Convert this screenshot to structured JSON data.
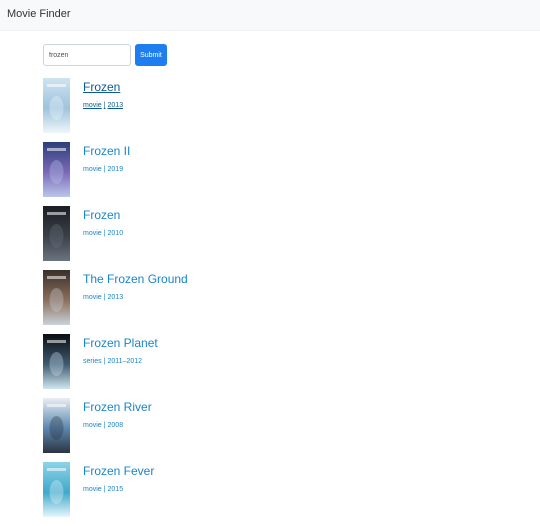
{
  "app": {
    "title": "Movie Finder"
  },
  "search": {
    "value": "frozen",
    "submit_label": "Submit"
  },
  "results": [
    {
      "title": "Frozen",
      "type": "movie",
      "year": "2013",
      "visited": true,
      "poster_colors": [
        "#cfe3f0",
        "#9ec3dc",
        "#eef6fb"
      ]
    },
    {
      "title": "Frozen II",
      "type": "movie",
      "year": "2019",
      "visited": false,
      "poster_colors": [
        "#2b3f7a",
        "#7b69b8",
        "#b9c6ea"
      ]
    },
    {
      "title": "Frozen",
      "type": "movie",
      "year": "2010",
      "visited": false,
      "poster_colors": [
        "#1a1d22",
        "#3b4048",
        "#6b7380"
      ]
    },
    {
      "title": "The Frozen Ground",
      "type": "movie",
      "year": "2013",
      "visited": false,
      "poster_colors": [
        "#3a2f2a",
        "#8b6f5c",
        "#c9d2da"
      ]
    },
    {
      "title": "Frozen Planet",
      "type": "series",
      "year": "2011–2012",
      "visited": false,
      "poster_colors": [
        "#0b0d12",
        "#3e5a70",
        "#cfe6f0"
      ]
    },
    {
      "title": "Frozen River",
      "type": "movie",
      "year": "2008",
      "visited": false,
      "poster_colors": [
        "#e9eef3",
        "#5c87b0",
        "#2b3442"
      ]
    },
    {
      "title": "Frozen Fever",
      "type": "movie",
      "year": "2015",
      "visited": false,
      "poster_colors": [
        "#8fd3e8",
        "#3fa9c9",
        "#e6f6fb"
      ]
    }
  ]
}
